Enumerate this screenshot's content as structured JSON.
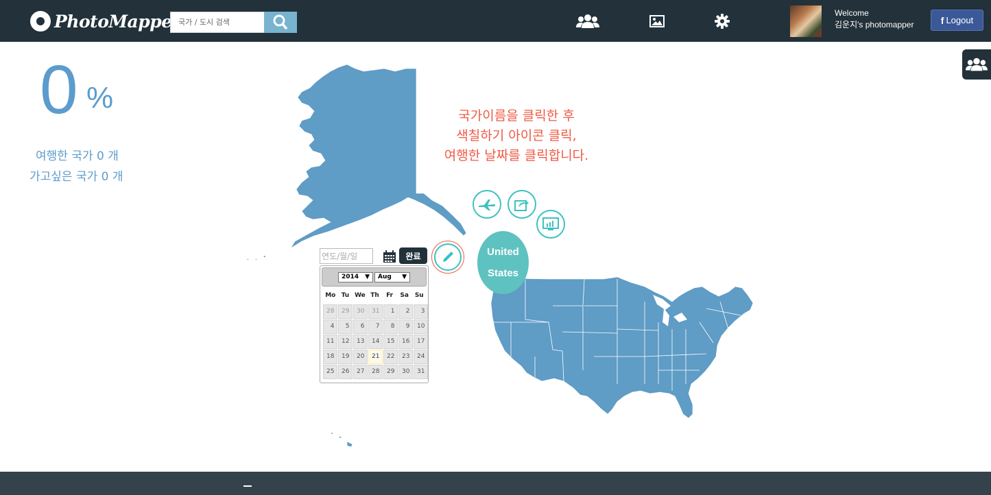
{
  "header": {
    "logo_text": "PhotoMapper",
    "search_placeholder": "국가 / 도시 검색",
    "search_button_icon": "search-icon",
    "nav_icons": [
      "friends-icon",
      "photo-icon",
      "settings-icon"
    ],
    "welcome_line1": "Welcome",
    "welcome_line2": "김운지's photomapper",
    "logout_label": "Logout",
    "logout_prefix": "f"
  },
  "side_tab": {
    "icon": "friends-icon"
  },
  "stats": {
    "percent_value": "0",
    "percent_sign": "%",
    "visited_line": "여행한 국가 0 개",
    "wish_line": "가고싶은 국가 0 개"
  },
  "instruction": {
    "line1": "국가이름을 클릭한 후",
    "line2": "색칠하기 아이콘 클릭,",
    "line3": "여행한 날짜를 클릭합니다."
  },
  "country_popup": {
    "line1": "United",
    "line2": "States",
    "icons": [
      "airplane-icon",
      "share-edit-icon",
      "chart-icon",
      "pencil-icon"
    ]
  },
  "date_form": {
    "placeholder": "연도/월/일",
    "done_label": "완료",
    "calendar_icon": "calendar-icon"
  },
  "datepicker": {
    "year": "2014",
    "month": "Aug",
    "weekdays": [
      "Mo",
      "Tu",
      "We",
      "Th",
      "Fr",
      "Sa",
      "Su"
    ],
    "weeks": [
      [
        "28",
        "29",
        "30",
        "31",
        "1",
        "2",
        "3"
      ],
      [
        "4",
        "5",
        "6",
        "7",
        "8",
        "9",
        "10"
      ],
      [
        "11",
        "12",
        "13",
        "14",
        "15",
        "16",
        "17"
      ],
      [
        "18",
        "19",
        "20",
        "21",
        "22",
        "23",
        "24"
      ],
      [
        "25",
        "26",
        "27",
        "28",
        "29",
        "30",
        "31"
      ]
    ],
    "today": "21"
  },
  "colors": {
    "header_bg": "#22313a",
    "map_fill": "#5f9cc6",
    "accent_teal": "#3ec1c0",
    "instruction_red": "#ef5a45",
    "facebook_blue": "#3b5998"
  }
}
